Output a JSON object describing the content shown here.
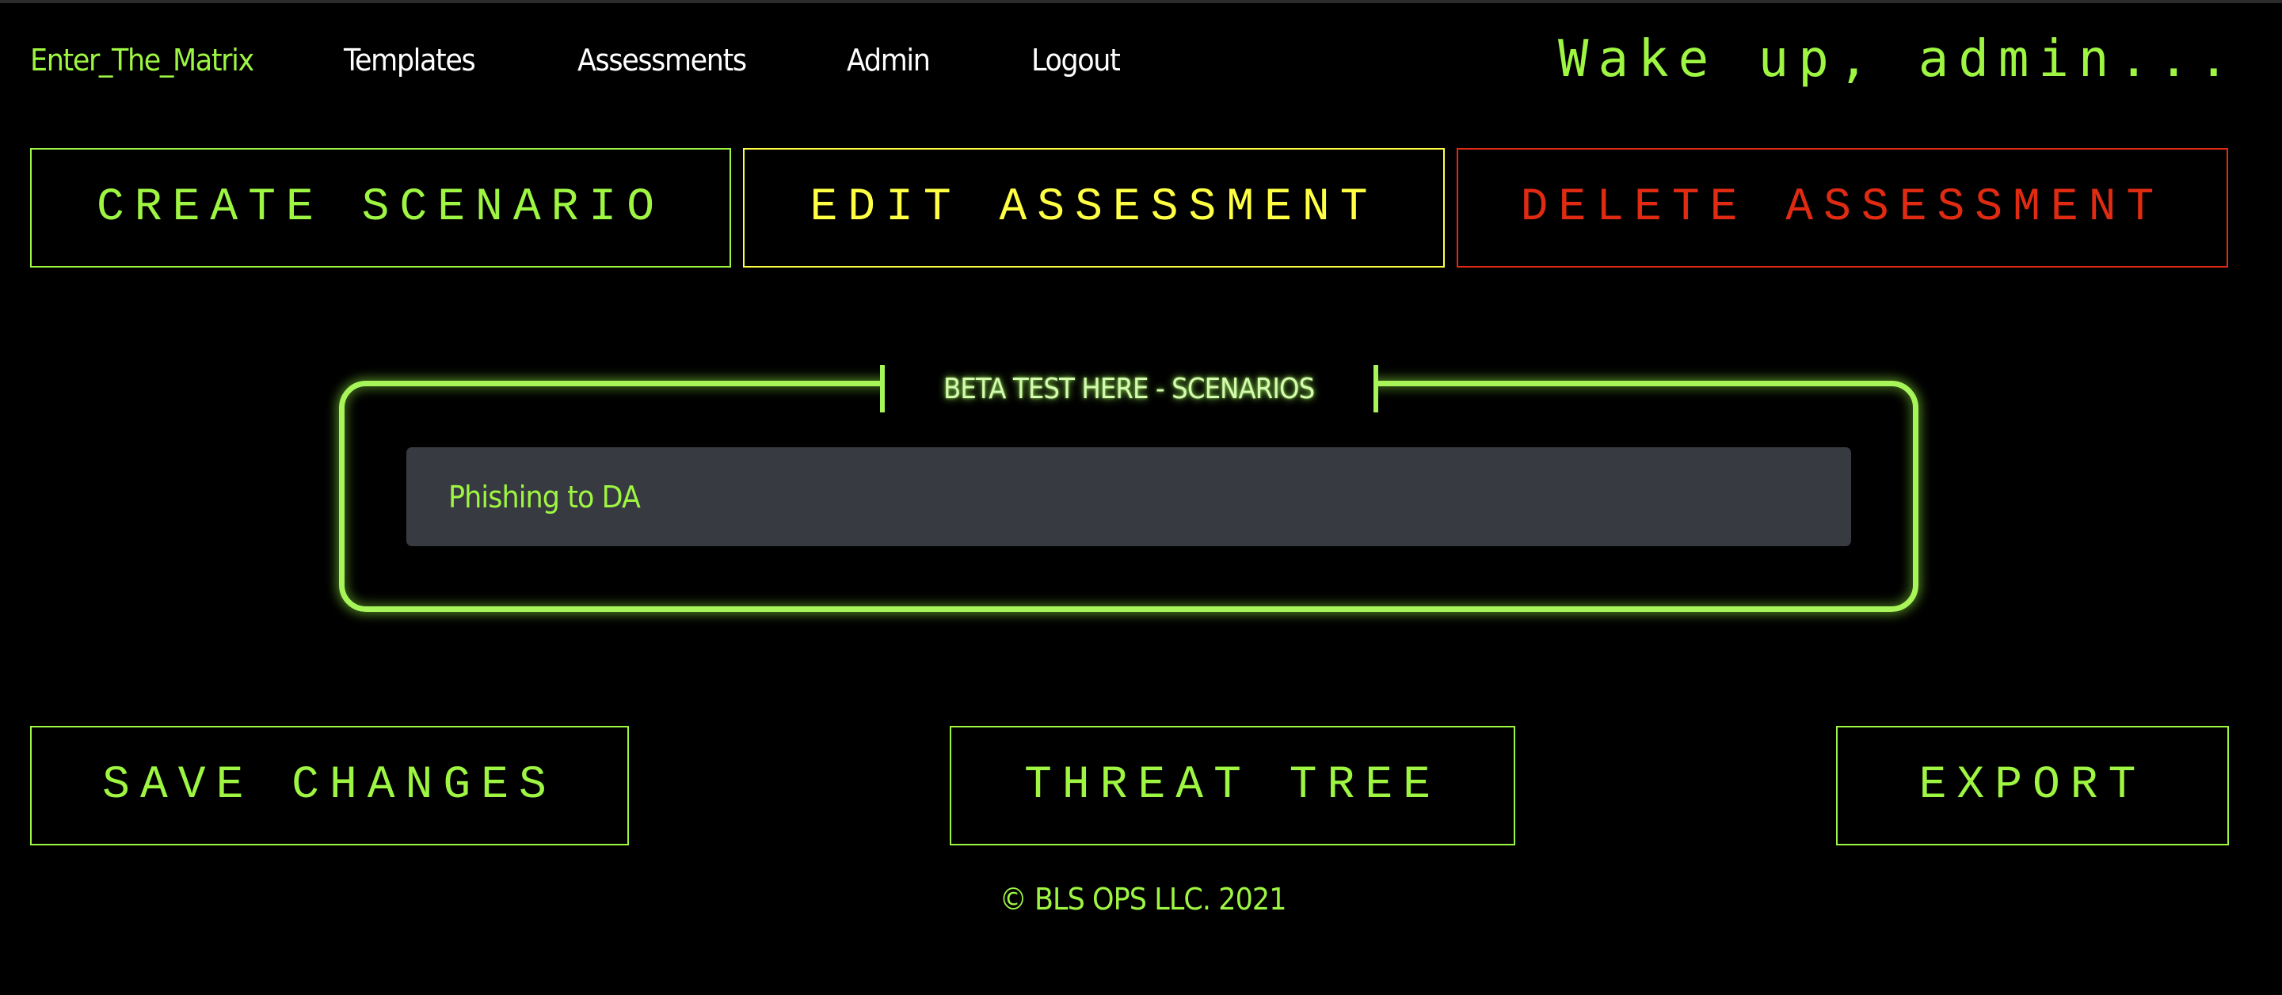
{
  "navbar": {
    "brand": "Enter_The_Matrix",
    "links": [
      {
        "label": "Templates"
      },
      {
        "label": "Assessments"
      },
      {
        "label": "Admin"
      },
      {
        "label": "Logout"
      }
    ],
    "greeting": "Wake up, admin..."
  },
  "actions_top": {
    "create_scenario": "CREATE SCENARIO",
    "edit_assessment": "EDIT ASSESSMENT",
    "delete_assessment": "DELETE ASSESSMENT"
  },
  "scenarios_panel": {
    "legend": "BETA TEST HERE - SCENARIOS",
    "items": [
      {
        "label": "Phishing to DA"
      }
    ]
  },
  "actions_bottom": {
    "save_changes": "SAVE CHANGES",
    "threat_tree": "THREAT TREE",
    "export": "EXPORT"
  },
  "footer": {
    "copyright": "© BLS OPS LLC. 2021"
  },
  "colors": {
    "background": "#000000",
    "accent_green": "#9ef542",
    "warning_yellow": "#ffff44",
    "danger_red": "#e02b12",
    "item_background": "#383a41"
  }
}
